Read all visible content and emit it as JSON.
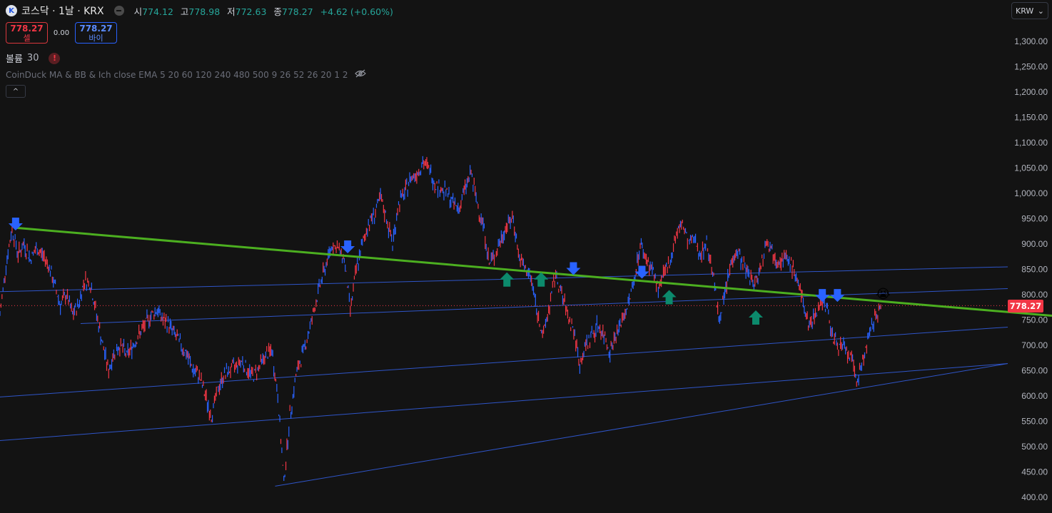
{
  "header": {
    "symbol_icon": "logo-icon",
    "title": "코스닥 · 1날 · KRX",
    "open_label": "시",
    "open": "774.12",
    "high_label": "고",
    "high": "778.98",
    "low_label": "저",
    "low": "772.63",
    "close_label": "종",
    "close": "778.27",
    "change": "+4.62 (+0.60%)"
  },
  "trade": {
    "sell_price": "778.27",
    "sell_label": "셀",
    "spread": "0.00",
    "buy_price": "778.27",
    "buy_label": "바이"
  },
  "volume": {
    "label": "볼륨",
    "value": "30",
    "warn": "!"
  },
  "indicator": {
    "name": "CoinDuck MA & BB & Ich close EMA 5 20 60 120 240 480 500 9 26 52 26 20 1 2"
  },
  "collapse_glyph": "^",
  "currency": {
    "selected": "KRW",
    "chevron": "⌄"
  },
  "last_price_tag": "778.27",
  "colors": {
    "background": "#131313",
    "candle_red": "#f23645",
    "candle_blue": "#2962ff",
    "green_line": "#4caf20",
    "channel_blue": "#2f55c8",
    "arrow_down_blue": "#2962ff",
    "arrow_up_teal": "#0c8a6c",
    "price_tag": "#f23645"
  },
  "chart_data": {
    "type": "line",
    "ylim": [
      390,
      1330
    ],
    "y_ticks": [
      400,
      450,
      500,
      550,
      600,
      650,
      700,
      750,
      800,
      850,
      900,
      950,
      1000,
      1050,
      1100,
      1150,
      1200,
      1250,
      1300
    ],
    "y_tick_labels": [
      "400.00",
      "450.00",
      "500.00",
      "550.00",
      "600.00",
      "650.00",
      "700.00",
      "750.00",
      "800.00",
      "850.00",
      "900.00",
      "950.00",
      "1,000.00",
      "1,050.00",
      "1,100.00",
      "1,150.00",
      "1,200.00",
      "1,250.00",
      "1,300.00"
    ],
    "grid": false,
    "last_price": 778.27,
    "series": [
      {
        "values": [
          760,
          860,
          930,
          880,
          900,
          870,
          890,
          880,
          860,
          820,
          780,
          800,
          760,
          780,
          830,
          820,
          760,
          700,
          650,
          690,
          700,
          680,
          700,
          720,
          740,
          760,
          770,
          750,
          740,
          720,
          700,
          680,
          650,
          640,
          600,
          560,
          610,
          640,
          650,
          660,
          670,
          650,
          640,
          660,
          680,
          690,
          600,
          430,
          560,
          640,
          680,
          720,
          770,
          820,
          860,
          900,
          890,
          870,
          770,
          850,
          900,
          940,
          960,
          990,
          950,
          900,
          980,
          1000,
          1030,
          1040,
          1060,
          1050,
          1020,
          1010,
          1000,
          980,
          970,
          1010,
          1040,
          980,
          940,
          860,
          880,
          910,
          940,
          950,
          870,
          850,
          830,
          760,
          720,
          780,
          840,
          800,
          760,
          730,
          660,
          700,
          720,
          740,
          720,
          690,
          720,
          750,
          780,
          830,
          900,
          870,
          850,
          810,
          840,
          870,
          920,
          940,
          900,
          910,
          880,
          900,
          850,
          750,
          800,
          860,
          890,
          860,
          840,
          820,
          860,
          910,
          880,
          870,
          870,
          860,
          830,
          780,
          740,
          760,
          790,
          770,
          710,
          700,
          690,
          670,
          630,
          680,
          720,
          760,
          778
        ]
      }
    ],
    "trendline": {
      "from": [
        0,
        932
      ],
      "to": [
        1,
        764
      ]
    },
    "channel_lines": [
      {
        "from": [
          0,
          806
        ],
        "to": [
          1,
          855
        ]
      },
      {
        "from": [
          0.08,
          743
        ],
        "to": [
          1,
          812
        ]
      },
      {
        "from": [
          0,
          598
        ],
        "to": [
          1,
          736
        ]
      },
      {
        "from": [
          0,
          512
        ],
        "to": [
          1,
          664
        ]
      },
      {
        "from": [
          0.273,
          422
        ],
        "to": [
          1,
          664
        ]
      }
    ],
    "down_arrows": [
      {
        "x": 0.0155,
        "y": 938
      },
      {
        "x": 0.345,
        "y": 893
      },
      {
        "x": 0.569,
        "y": 850
      },
      {
        "x": 0.637,
        "y": 843
      },
      {
        "x": 0.816,
        "y": 797
      },
      {
        "x": 0.831,
        "y": 797
      }
    ],
    "up_arrows": [
      {
        "x": 0.503,
        "y": 830
      },
      {
        "x": 0.537,
        "y": 830
      },
      {
        "x": 0.664,
        "y": 795
      },
      {
        "x": 0.75,
        "y": 755
      }
    ],
    "emoji": {
      "x": 0.876,
      "y": 803,
      "glyph": "😭"
    }
  }
}
